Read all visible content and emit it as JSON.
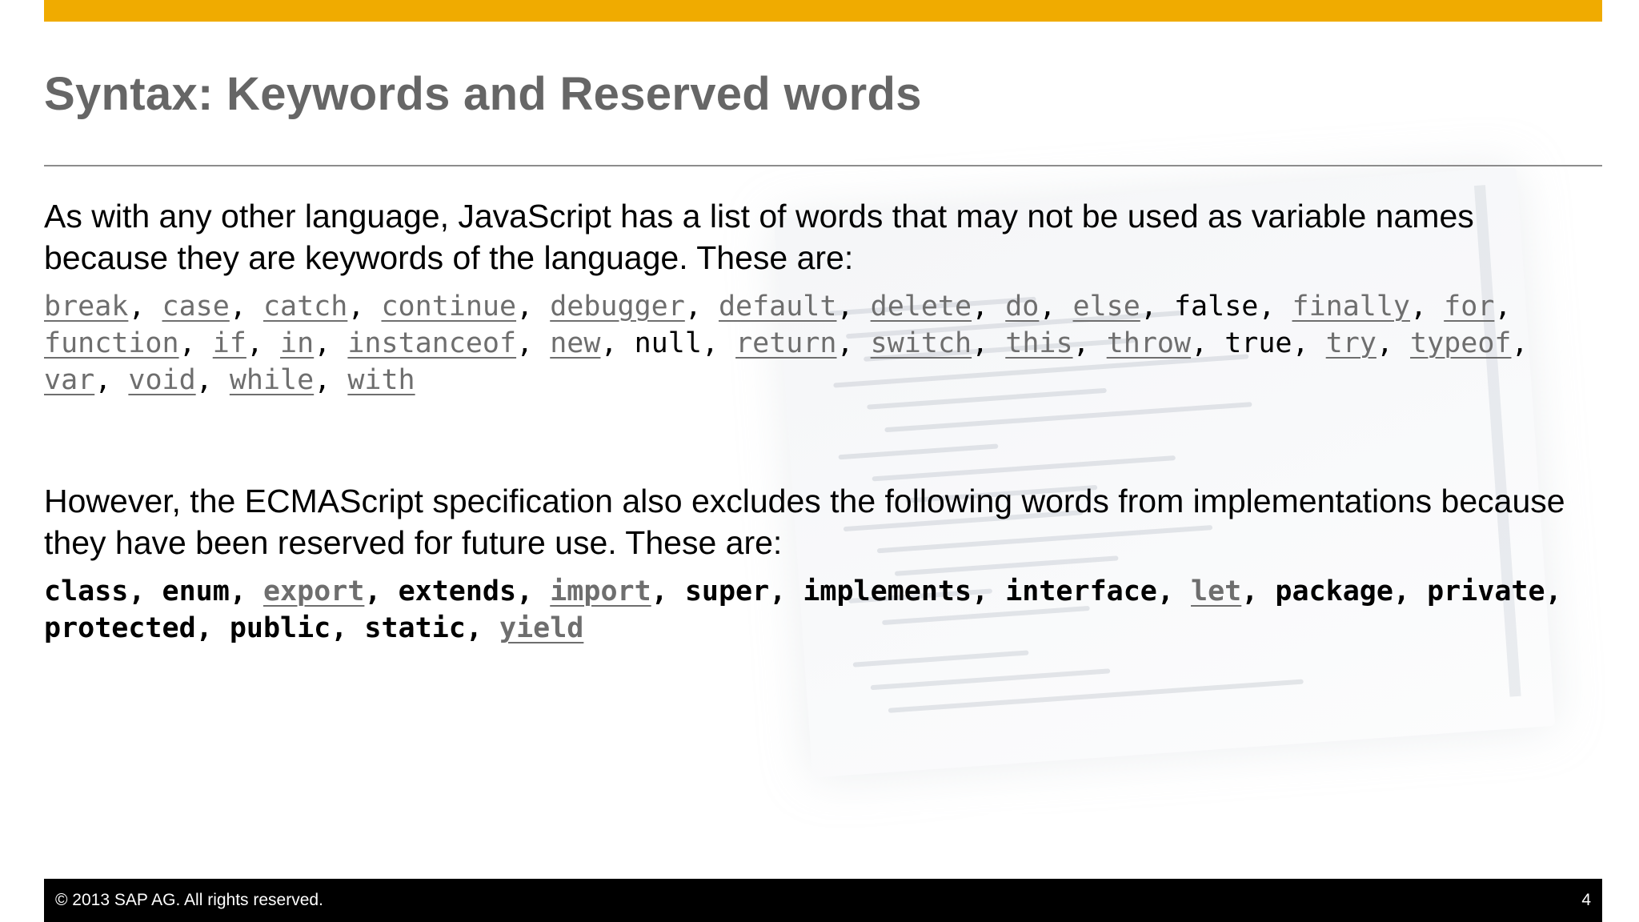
{
  "slide": {
    "title": "Syntax: Keywords and Reserved words",
    "intro_text": "As with any other language, JavaScript has a list of words that may not be used as variable names because they are keywords of the language.  These are:",
    "keywords": [
      {
        "word": "break",
        "linked": true
      },
      {
        "word": "case",
        "linked": true
      },
      {
        "word": "catch",
        "linked": true
      },
      {
        "word": "continue",
        "linked": true
      },
      {
        "word": "debugger",
        "linked": true
      },
      {
        "word": "default",
        "linked": true
      },
      {
        "word": "delete",
        "linked": true
      },
      {
        "word": "do",
        "linked": true
      },
      {
        "word": "else",
        "linked": true
      },
      {
        "word": "false",
        "linked": false
      },
      {
        "word": "finally",
        "linked": true
      },
      {
        "word": "for",
        "linked": true
      },
      {
        "word": "function",
        "linked": true
      },
      {
        "word": "if",
        "linked": true
      },
      {
        "word": "in",
        "linked": true
      },
      {
        "word": "instanceof",
        "linked": true
      },
      {
        "word": "new",
        "linked": true
      },
      {
        "word": "null",
        "linked": false
      },
      {
        "word": "return",
        "linked": true
      },
      {
        "word": "switch",
        "linked": true
      },
      {
        "word": "this",
        "linked": true
      },
      {
        "word": "throw",
        "linked": true
      },
      {
        "word": "true",
        "linked": false
      },
      {
        "word": "try",
        "linked": true
      },
      {
        "word": "typeof",
        "linked": true
      },
      {
        "word": "var",
        "linked": true
      },
      {
        "word": "void",
        "linked": true
      },
      {
        "word": "while",
        "linked": true
      },
      {
        "word": "with",
        "linked": true
      }
    ],
    "reserved_intro_text": "However, the ECMAScript specification also excludes the following words from implementations because they have been reserved for future use.  These are:",
    "reserved_words": [
      {
        "word": "class",
        "linked": false
      },
      {
        "word": "enum",
        "linked": false
      },
      {
        "word": "export",
        "linked": true
      },
      {
        "word": "extends",
        "linked": false
      },
      {
        "word": "import",
        "linked": true
      },
      {
        "word": "super",
        "linked": false
      },
      {
        "word": "implements",
        "linked": false
      },
      {
        "word": "interface",
        "linked": false
      },
      {
        "word": "let",
        "linked": true
      },
      {
        "word": "package",
        "linked": false
      },
      {
        "word": "private",
        "linked": false
      },
      {
        "word": "protected",
        "linked": false
      },
      {
        "word": "public",
        "linked": false
      },
      {
        "word": "static",
        "linked": false
      },
      {
        "word": "yield",
        "linked": true
      }
    ],
    "separator": ", "
  },
  "footer": {
    "copyright": "©  2013 SAP AG. All rights reserved.",
    "page_number": "4"
  },
  "colors": {
    "accent_bar": "#f0ab00",
    "title": "#666666",
    "link": "#6e6e6e",
    "footer_bg": "#000000"
  }
}
